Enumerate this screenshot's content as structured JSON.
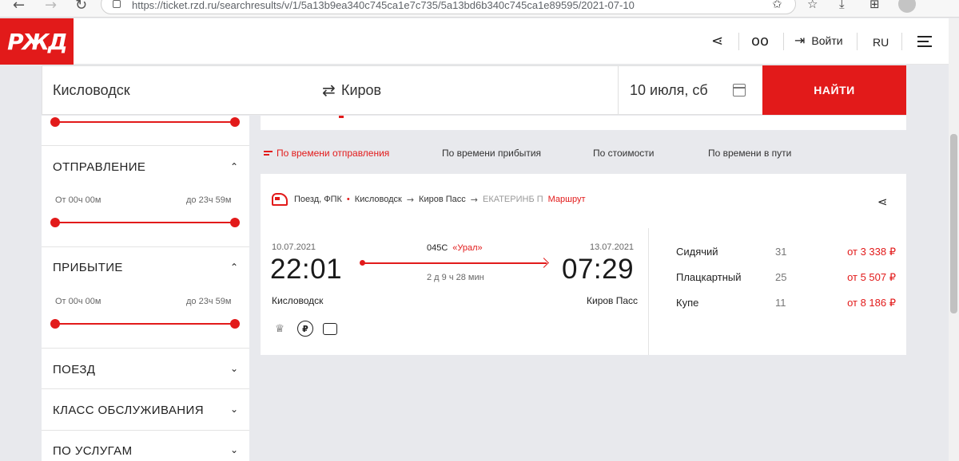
{
  "browser": {
    "url": "https://ticket.rzd.ru/searchresults/v/1/5a13b9ea340c745ca1e7c735/5a13bd6b340c745ca1e89595/2021-07-10"
  },
  "header": {
    "logo_text": "РЖД",
    "login_label": "Войти",
    "lang_label": "RU"
  },
  "search": {
    "from": "Кисловодск",
    "to": "Киров",
    "date": "10 июля, сб",
    "button_label": "НАЙТИ"
  },
  "filters": {
    "departure": {
      "title": "ОТПРАВЛЕНИЕ",
      "from_label": "От 00ч 00м",
      "to_label": "до 23ч 59м"
    },
    "arrival": {
      "title": "ПРИБЫТИЕ",
      "from_label": "От 00ч 00м",
      "to_label": "до 23ч 59м"
    },
    "collapsed": [
      {
        "title": "ПОЕЗД"
      },
      {
        "title": "КЛАСС ОБСЛУЖИВАНИЯ"
      },
      {
        "title": "ПО УСЛУГАМ"
      }
    ]
  },
  "sort": {
    "options": [
      {
        "label": "По времени отправления",
        "active": true
      },
      {
        "label": "По времени прибытия",
        "active": false
      },
      {
        "label": "По стоимости",
        "active": false
      },
      {
        "label": "По времени в пути",
        "active": false
      }
    ]
  },
  "train": {
    "type": "Поезд, ФПК",
    "route_from": "Кисловодск",
    "route_to": "Киров Пасс",
    "route_final": "ЕКАТЕРИНБ П",
    "route_link": "Маршрут",
    "departure_date": "10.07.2021",
    "departure_time": "22:01",
    "departure_station": "Кисловодск",
    "arrival_date": "13.07.2021",
    "arrival_time": "07:29",
    "arrival_station": "Киров Пасс",
    "number": "045С",
    "brand": "«Урал»",
    "duration": "2 д 9 ч 28 мин",
    "fares": [
      {
        "name": "Сидячий",
        "seats": "31",
        "price": "от 3 338 ₽"
      },
      {
        "name": "Плацкартный",
        "seats": "25",
        "price": "от 5 507 ₽"
      },
      {
        "name": "Купе",
        "seats": "11",
        "price": "от 8 186 ₽"
      }
    ]
  },
  "colors": {
    "accent": "#e21a1a",
    "background": "#e8e9ed"
  }
}
